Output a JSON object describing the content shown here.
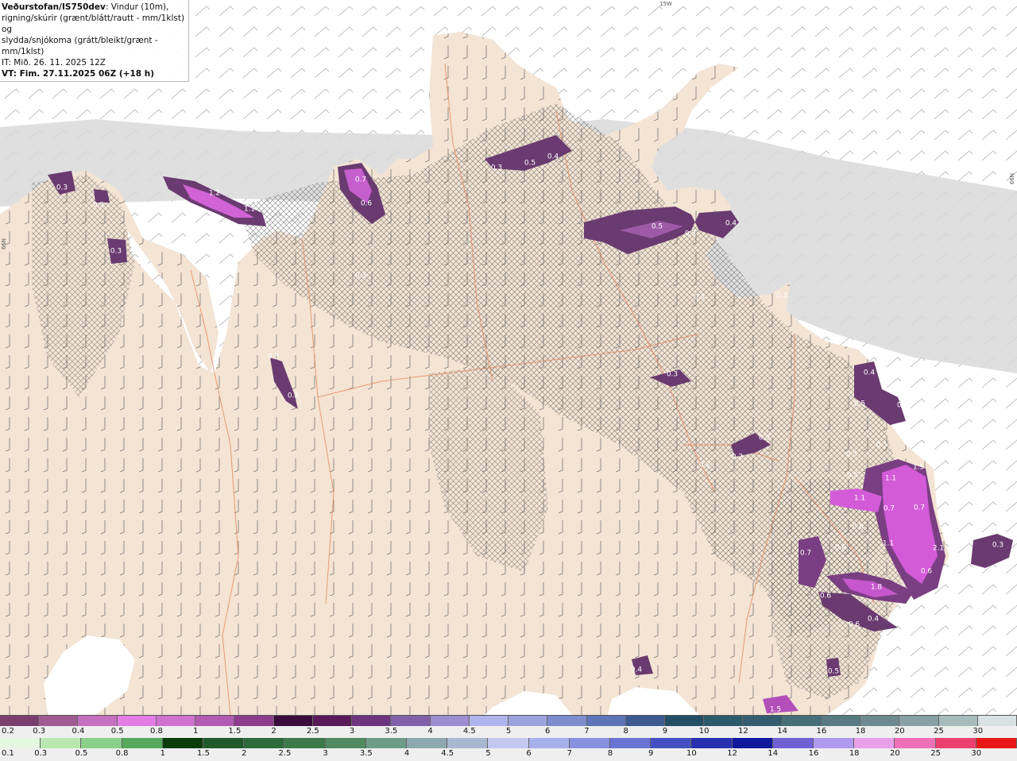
{
  "header": {
    "brand": "Veðurstofan/IS750dev",
    "line1_rest": ": Vindur (10m),",
    "line2": "rigning/skúrir (grænt/blátt/rautt - mm/1klst) og",
    "line3": "slydda/snjókoma (grátt/bleikt/grænt - mm/1klst)",
    "line4": "IT: Mið. 26. 11. 2025 12Z",
    "line5": "VT: Fim. 27.11.2025 06Z (+18 h)"
  },
  "axis_labels": {
    "top": "15W",
    "left": "66N",
    "right": "66N"
  },
  "precip_labels": [
    {
      "value": "0.3"
    },
    {
      "value": "0.3"
    },
    {
      "value": "0.3"
    },
    {
      "value": "1.2"
    },
    {
      "value": "1.1"
    },
    {
      "value": "0.7"
    },
    {
      "value": "0.6"
    },
    {
      "value": "0.3"
    },
    {
      "value": "0.3"
    },
    {
      "value": "0.5"
    },
    {
      "value": "0.4"
    },
    {
      "value": "0.5"
    },
    {
      "value": "0.3"
    },
    {
      "value": "0.4"
    },
    {
      "value": "0.3"
    },
    {
      "value": "0.3"
    },
    {
      "value": "0.3"
    },
    {
      "value": "0.2"
    },
    {
      "value": "0.3"
    },
    {
      "value": "0.2"
    },
    {
      "value": "0.3"
    },
    {
      "value": "0.2"
    },
    {
      "value": "0.4"
    },
    {
      "value": "0.5"
    },
    {
      "value": "0.6"
    },
    {
      "value": "0.5"
    },
    {
      "value": "0.5"
    },
    {
      "value": "0.5"
    },
    {
      "value": "1.1"
    },
    {
      "value": "1.5"
    },
    {
      "value": "1.1"
    },
    {
      "value": "0.7"
    },
    {
      "value": "0.7"
    },
    {
      "value": "0.6"
    },
    {
      "value": "1.1"
    },
    {
      "value": "2.1"
    },
    {
      "value": "0.7"
    },
    {
      "value": "0.6"
    },
    {
      "value": "0.6"
    },
    {
      "value": "1.8"
    },
    {
      "value": "0.6"
    },
    {
      "value": "0.4"
    },
    {
      "value": "0.6"
    },
    {
      "value": "0.3"
    },
    {
      "value": "0.4"
    },
    {
      "value": "0.5"
    },
    {
      "value": "1.5"
    }
  ],
  "legend_snow": {
    "labels": [
      "0.2",
      "0.3",
      "0.4",
      "0.5",
      "0.8",
      "1",
      "1.5",
      "2",
      "2.5",
      "3",
      "3.5",
      "4",
      "4.5",
      "5",
      "6",
      "7",
      "8",
      "9",
      "10",
      "12",
      "14",
      "16",
      "18",
      "20",
      "25",
      "30"
    ],
    "colors": [
      "#7a3f6e",
      "#a05c92",
      "#c56fc0",
      "#e47ce6",
      "#cf72cf",
      "#b35ab3",
      "#8e3c8e",
      "#3b0c3b",
      "#5a1a5a",
      "#6e3480",
      "#8060a8",
      "#9c8cd0",
      "#b0b4ec",
      "#9ca4de",
      "#7d8ccd",
      "#5d74b6",
      "#3c5a90",
      "#244d66",
      "#2b5b6a",
      "#345e70",
      "#466e78",
      "#587a82",
      "#6e8a90",
      "#86a0a4",
      "#a6bcbc",
      "#d8e2e2"
    ]
  },
  "legend_rain": {
    "labels": [
      "0.1",
      "0.3",
      "0.5",
      "0.8",
      "1",
      "1.5",
      "2",
      "2.5",
      "3",
      "3.5",
      "4",
      "4.5",
      "5",
      "6",
      "7",
      "8",
      "9",
      "10",
      "12",
      "14",
      "16",
      "18",
      "20",
      "25",
      "30"
    ],
    "colors": [
      "#e4f7e0",
      "#b8e8b0",
      "#8ad08a",
      "#56a85a",
      "#0a3d0a",
      "#1f5a2a",
      "#2d6b3b",
      "#3d7a4a",
      "#4f8a60",
      "#6e9c88",
      "#8ea8b0",
      "#a8b8d0",
      "#c4c8ee",
      "#a8b0ec",
      "#8890e0",
      "#6a74d4",
      "#4450c2",
      "#2830b0",
      "#10189c",
      "#7060d4",
      "#b09af0",
      "#e8a0e8",
      "#f070b8",
      "#ec4070",
      "#e81818"
    ]
  }
}
